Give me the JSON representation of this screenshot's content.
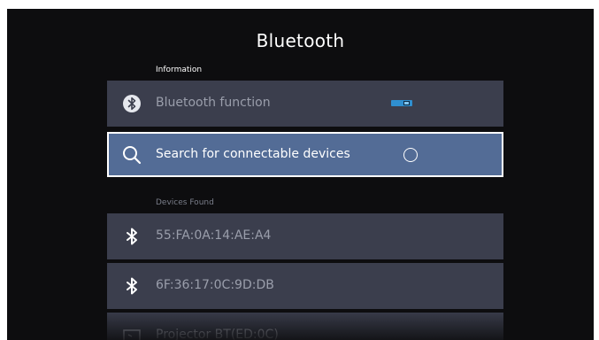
{
  "page": {
    "title": "Bluetooth"
  },
  "sections": {
    "information": "Information",
    "devices_found": "Devices Found"
  },
  "settings": {
    "bluetooth_function": {
      "label": "Bluetooth function",
      "icon": "bluetooth-circle-icon",
      "enabled": true
    },
    "search": {
      "label": "Search for connectable devices",
      "icon": "search-icon",
      "checked": false
    }
  },
  "devices": [
    {
      "name": "55:FA:0A:14:AE:A4",
      "icon": "bluetooth-icon"
    },
    {
      "name": "6F:36:17:0C:9D:DB",
      "icon": "bluetooth-icon"
    },
    {
      "name": "Projector BT(ED:0C)",
      "icon": "projector-icon"
    }
  ],
  "colors": {
    "background": "#0d0d0f",
    "row": "#3b3e4d",
    "focused_row": "#536c96",
    "toggle_on": "#2f8fd0"
  }
}
